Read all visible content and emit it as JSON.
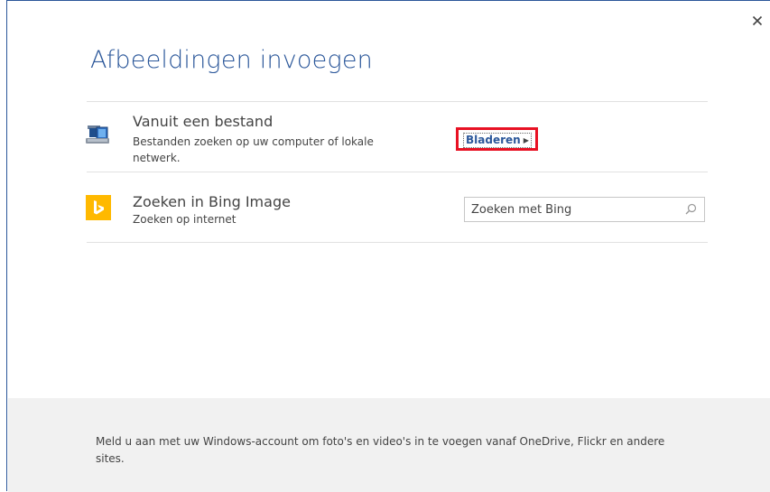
{
  "dialog": {
    "title": "Afbeeldingen invoegen",
    "close_icon": "close-icon"
  },
  "file_row": {
    "title": "Vanuit een bestand",
    "description": "Bestanden zoeken op uw computer of lokale netwerk.",
    "icon": "computer-icon",
    "browse_label": "Bladeren",
    "browse_arrow_icon": "triangle-right-icon",
    "highlight_color": "#e81123"
  },
  "bing_row": {
    "title": "Zoeken in Bing Image",
    "description": "Zoeken op internet",
    "icon": "bing-logo-icon",
    "search_placeholder": "Zoeken met Bing",
    "search_icon": "search-icon"
  },
  "footer": {
    "text": "Meld u aan met uw Windows-account om foto's en video's in te voegen vanaf OneDrive, Flickr en andere sites."
  },
  "colors": {
    "accent": "#2b579a",
    "bing": "#ffb900",
    "footer_bg": "#f1f1f1"
  }
}
